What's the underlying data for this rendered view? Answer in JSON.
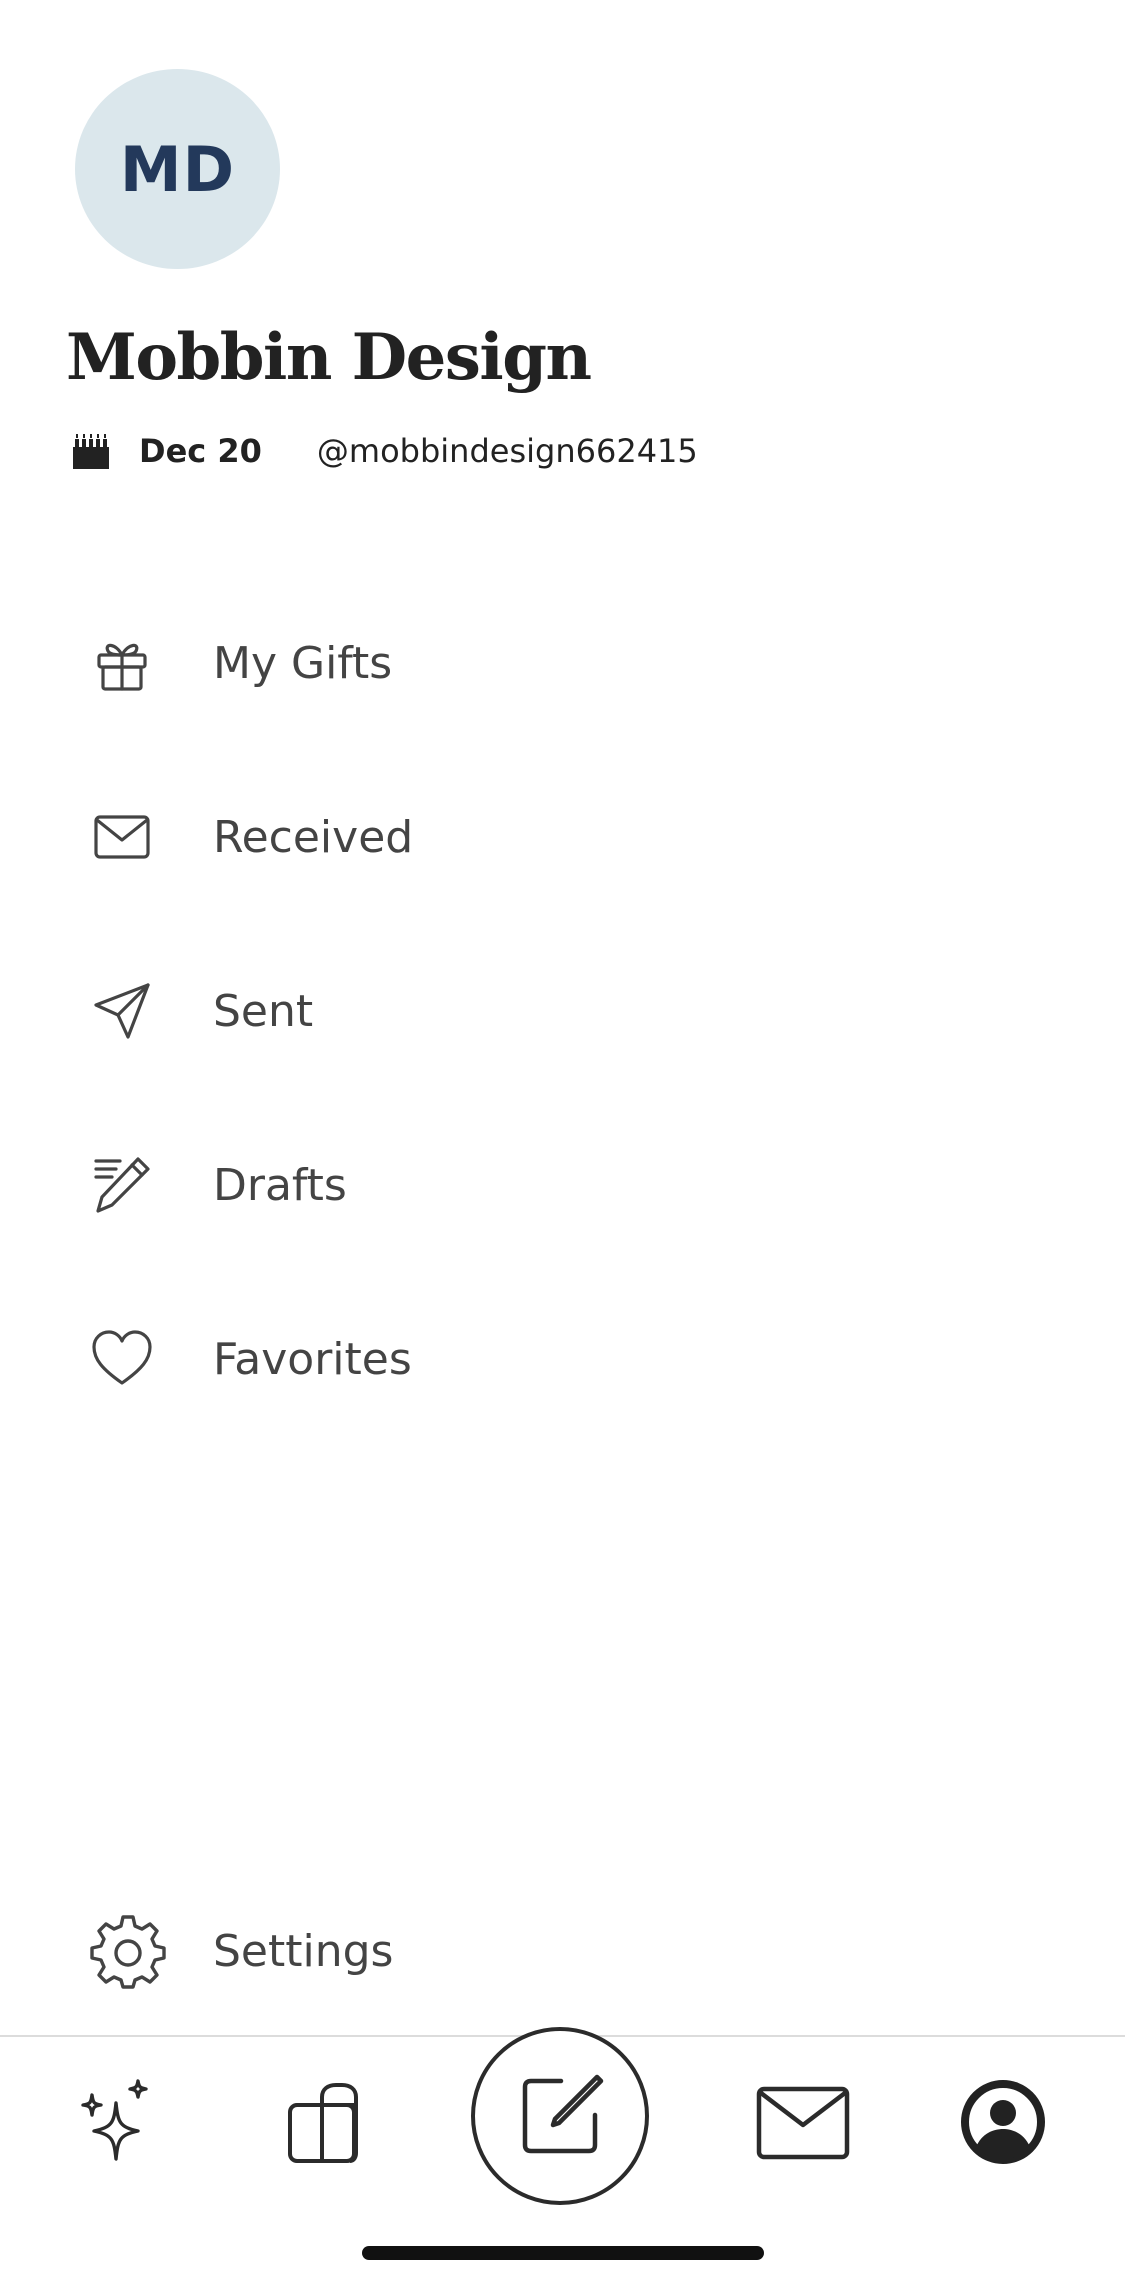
{
  "profile": {
    "initials": "MD",
    "name": "Mobbin Design",
    "birthday": "Dec 20",
    "handle": "@mobbindesign662415"
  },
  "menu": {
    "items": [
      {
        "label": "My Gifts",
        "icon": "gift-icon"
      },
      {
        "label": "Received",
        "icon": "envelope-icon"
      },
      {
        "label": "Sent",
        "icon": "paper-plane-icon"
      },
      {
        "label": "Drafts",
        "icon": "pencil-lines-icon"
      },
      {
        "label": "Favorites",
        "icon": "heart-icon"
      }
    ],
    "settings": {
      "label": "Settings",
      "icon": "gear-icon"
    }
  },
  "tabbar": {
    "tabs": [
      {
        "icon": "sparkles-icon"
      },
      {
        "icon": "gift-bag-icon"
      },
      {
        "icon": "compose-icon"
      },
      {
        "icon": "envelope-icon"
      },
      {
        "icon": "user-circle-icon",
        "active": true
      }
    ]
  },
  "colors": {
    "avatar_bg": "#dbe7ec",
    "avatar_text": "#23395b",
    "text_primary": "#222222",
    "menu_text": "#444444",
    "divider": "#dcdcdc"
  }
}
